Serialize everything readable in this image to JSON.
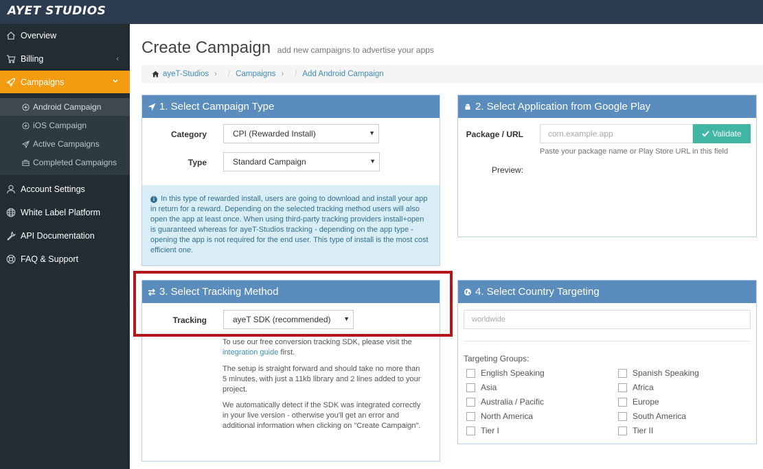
{
  "brand": {
    "logo_text": "AYET STUDIOS"
  },
  "sidebar": {
    "items": [
      {
        "label": "Overview",
        "icon": "home-icon"
      },
      {
        "label": "Billing",
        "icon": "cart-icon",
        "caret": "‹"
      },
      {
        "label": "Campaigns",
        "icon": "rocket-icon",
        "caret": "⌄"
      },
      {
        "label": "Account Settings",
        "icon": "user-icon"
      },
      {
        "label": "White Label Platform",
        "icon": "globe-icon"
      },
      {
        "label": "API Documentation",
        "icon": "wrench-icon"
      },
      {
        "label": "FAQ & Support",
        "icon": "lifebuoy-icon"
      }
    ],
    "submenu": [
      {
        "label": "Android Campaign",
        "icon": "plus-circle-icon"
      },
      {
        "label": "iOS Campaign",
        "icon": "plus-circle-icon"
      },
      {
        "label": "Active Campaigns",
        "icon": "paper-plane-icon"
      },
      {
        "label": "Completed Campaigns",
        "icon": "briefcase-icon"
      }
    ]
  },
  "header": {
    "title": "Create Campaign",
    "subtitle": "add new campaigns to advertise your apps",
    "breadcrumb": [
      "ayeT-Studios",
      "Campaigns",
      "Add Android Campaign"
    ]
  },
  "panel1": {
    "title": "1. Select Campaign Type",
    "category_label": "Category",
    "category_value": "CPI (Rewarded Install)",
    "type_label": "Type",
    "type_value": "Standard Campaign",
    "info": "In this type of rewarded install, users are going to download and install your app in return for a reward. Depending on the selected tracking method users will also open the app at least once. When using third-party tracking providers install+open is guaranteed whereas for ayeT-Studios tracking - depending on the app type - opening the app is not required for the end user. This type of install is the most cost efficient one."
  },
  "panel2": {
    "title": "2. Select Application from Google Play",
    "package_label": "Package / URL",
    "package_placeholder": "com.example.app",
    "validate_label": "Validate",
    "help": "Paste your package name or Play Store URL in this field",
    "preview_label": "Preview:"
  },
  "panel3": {
    "title": "3. Select Tracking Method",
    "tracking_label": "Tracking",
    "tracking_value": "ayeT SDK (recommended)",
    "p1_before": "To use our free conversion tracking SDK, please visit the",
    "p1_link": "integration guide",
    "p1_after": "first.",
    "p2": "The setup is straight forward and should take no more than 5 minutes, with just a 11kb library and 2 lines added to your project.",
    "p3": "We automatically detect if the SDK was integrated correctly in your live version - otherwise you'll get an error and additional information when clicking on \"Create Campaign\"."
  },
  "panel4": {
    "title": "4. Select Country Targeting",
    "country_placeholder": "worldwide",
    "groups_label": "Targeting Groups:",
    "groups_left": [
      "English Speaking",
      "Asia",
      "Australia / Pacific",
      "North America",
      "Tier I"
    ],
    "groups_right": [
      "Spanish Speaking",
      "Africa",
      "Europe",
      "South America",
      "Tier II"
    ]
  }
}
